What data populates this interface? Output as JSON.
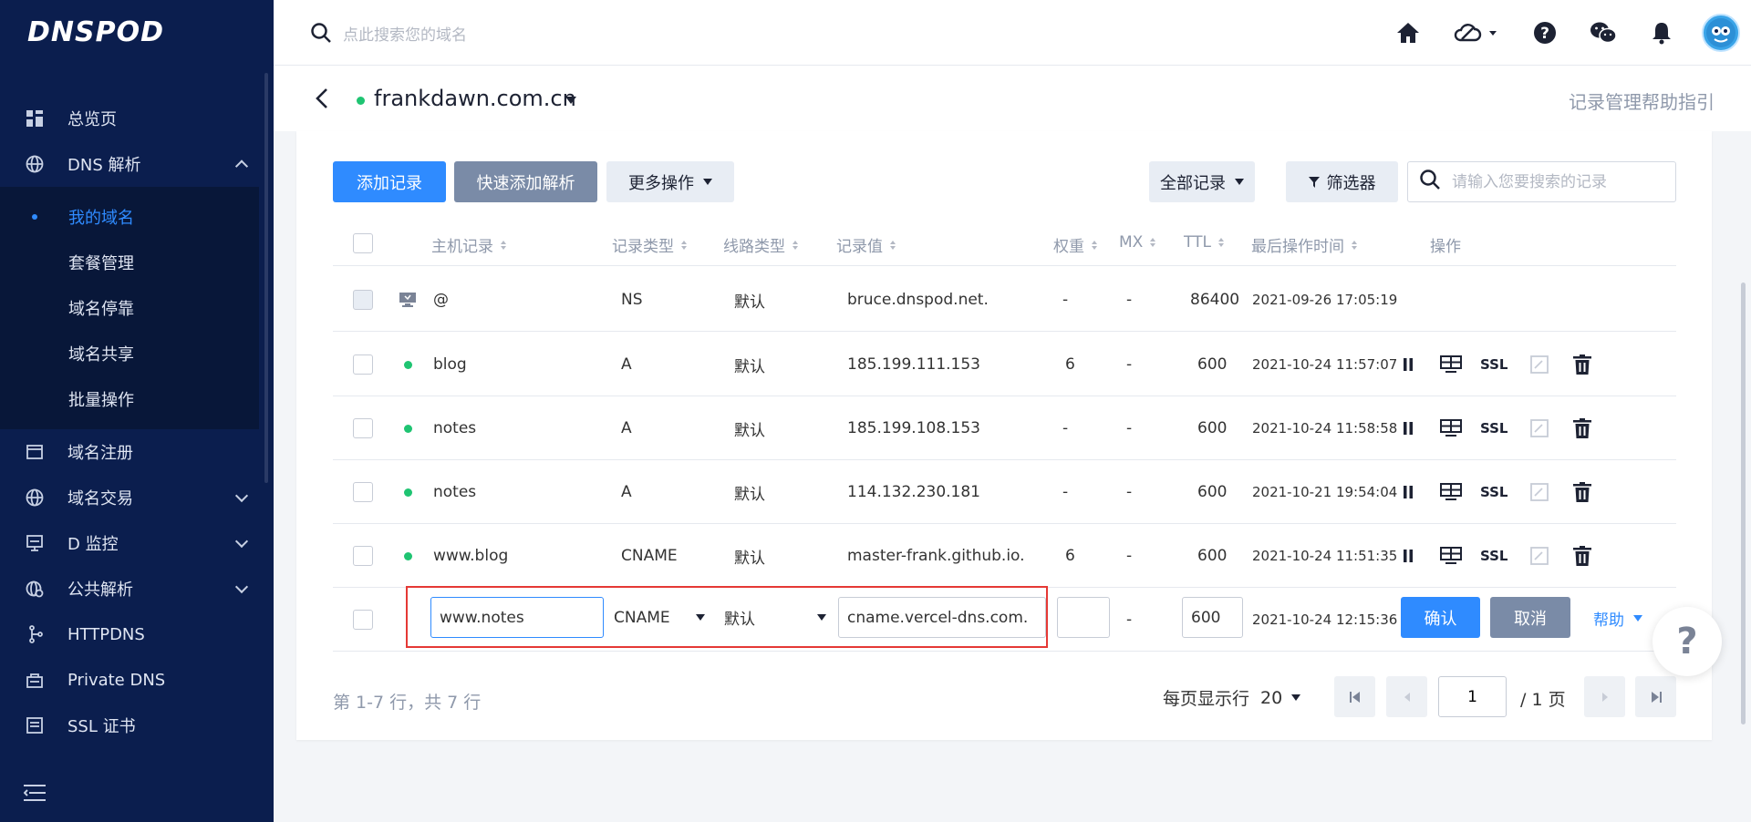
{
  "app": {
    "logo": "DNSPOD"
  },
  "sidebar": {
    "items": [
      {
        "label": "总览页",
        "icon": "dashboard-icon"
      },
      {
        "label": "DNS 解析",
        "icon": "globe-icon",
        "expanded": true
      },
      {
        "label": "域名注册",
        "icon": "calendar-icon"
      },
      {
        "label": "域名交易",
        "icon": "globe-icon"
      },
      {
        "label": "D 监控",
        "icon": "monitor-icon"
      },
      {
        "label": "公共解析",
        "icon": "public-dns-icon"
      },
      {
        "label": "HTTPDNS",
        "icon": "nodes-icon"
      },
      {
        "label": "Private DNS",
        "icon": "lock-box-icon"
      },
      {
        "label": "SSL 证书",
        "icon": "certificate-icon"
      }
    ],
    "dns_sub": [
      "我的域名",
      "套餐管理",
      "域名停靠",
      "域名共享",
      "批量操作"
    ]
  },
  "topbar": {
    "search_placeholder": "点此搜索您的域名"
  },
  "domain": {
    "name": "frankdawn.com.cn",
    "help_link": "记录管理帮助指引"
  },
  "toolbar": {
    "add_record": "添加记录",
    "quick_add": "快速添加解析",
    "more_ops": "更多操作",
    "all_records": "全部记录",
    "filter": "筛选器",
    "search_placeholder": "请输入您要搜索的记录"
  },
  "table": {
    "headers": {
      "host": "主机记录",
      "type": "记录类型",
      "line": "线路类型",
      "value": "记录值",
      "weight": "权重",
      "mx": "MX",
      "ttl": "TTL",
      "time": "最后操作时间",
      "ops": "操作"
    },
    "rows": [
      {
        "host": "@",
        "type": "NS",
        "line": "默认",
        "value": "bruce.dnspod.net.",
        "weight": "-",
        "mx": "-",
        "ttl": "86400",
        "time": "2021-09-26 17:05:19"
      },
      {
        "host": "blog",
        "type": "A",
        "line": "默认",
        "value": "185.199.111.153",
        "weight": "6",
        "mx": "-",
        "ttl": "600",
        "time": "2021-10-24 11:57:07",
        "ssl": "SSL"
      },
      {
        "host": "notes",
        "type": "A",
        "line": "默认",
        "value": "185.199.108.153",
        "weight": "-",
        "mx": "-",
        "ttl": "600",
        "time": "2021-10-24 11:58:58",
        "ssl": "SSL"
      },
      {
        "host": "notes",
        "type": "A",
        "line": "默认",
        "value": "114.132.230.181",
        "weight": "-",
        "mx": "-",
        "ttl": "600",
        "time": "2021-10-21 19:54:04",
        "ssl": "SSL"
      },
      {
        "host": "www.blog",
        "type": "CNAME",
        "line": "默认",
        "value": "master-frank.github.io.",
        "weight": "6",
        "mx": "-",
        "ttl": "600",
        "time": "2021-10-24 11:51:35",
        "ssl": "SSL"
      }
    ],
    "edit_row": {
      "host": "www.notes",
      "type": "CNAME",
      "line": "默认",
      "value": "cname.vercel-dns.com.",
      "weight": "",
      "mx": "-",
      "ttl": "600",
      "time": "2021-10-24 12:15:36",
      "confirm": "确认",
      "cancel": "取消",
      "help": "帮助"
    }
  },
  "pagination": {
    "info": "第 1-7 行，共 7 行",
    "per_page_label": "每页显示行",
    "per_page": "20",
    "current_page": "1",
    "total": "/ 1 页"
  },
  "colors": {
    "sidebar": "#0b1e4e",
    "primary": "#2f8bff",
    "secondary": "#7a8ba7",
    "active_dot": "#1fc472",
    "highlight_border": "#e53935"
  }
}
